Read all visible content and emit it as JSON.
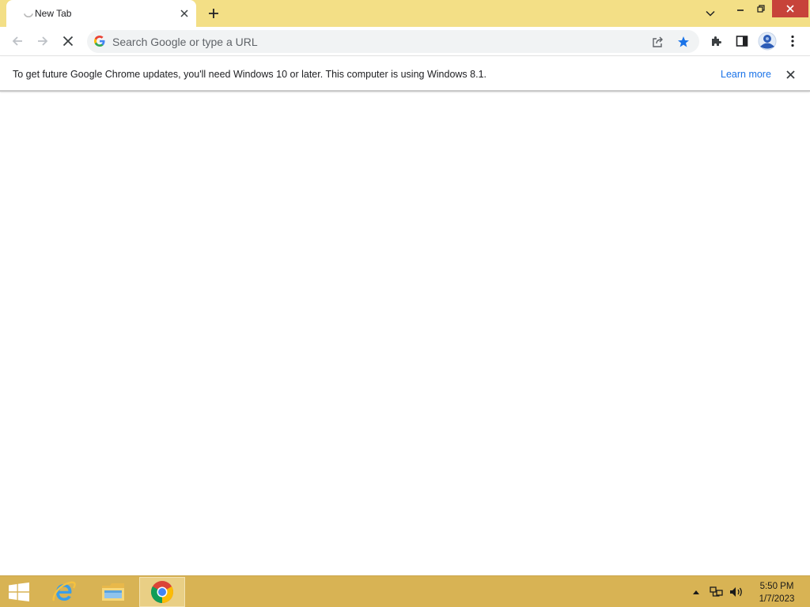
{
  "tab": {
    "title": "New Tab",
    "spinner_icon": "loading-spinner-icon",
    "close_icon": "close-icon"
  },
  "toolbar": {
    "back_icon": "arrow-left-icon",
    "forward_icon": "arrow-right-icon",
    "stop_icon": "close-icon",
    "extensions_icon": "puzzle-icon",
    "side_panel_icon": "side-panel-icon",
    "menu_icon": "kebab-menu-icon"
  },
  "omnibox": {
    "placeholder": "Search Google or type a URL",
    "value": ""
  },
  "infobar": {
    "message": "To get future Google Chrome updates, you'll need Windows 10 or later. This computer is using Windows 8.1.",
    "link_label": "Learn more"
  },
  "taskbar": {
    "apps": [
      "Internet Explorer",
      "File Explorer",
      "Google Chrome"
    ],
    "active_app": "Google Chrome",
    "time": "5:50 PM",
    "date": "1/7/2023"
  },
  "colors": {
    "frame": "#f3df86",
    "taskbar": "#d8b354",
    "link": "#1a73e8",
    "star": "#1a73e8",
    "close_button": "#c7433a"
  }
}
